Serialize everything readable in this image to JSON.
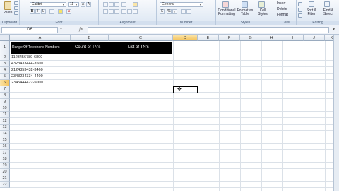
{
  "ribbon": {
    "clipboard": {
      "paste_label": "Paste",
      "group_label": "Clipboard"
    },
    "font": {
      "font_name": "Calibri",
      "font_size": "11",
      "bold": "B",
      "italic": "I",
      "underline": "U",
      "group_label": "Font"
    },
    "alignment": {
      "group_label": "Alignment"
    },
    "number": {
      "format": "General",
      "currency": "$",
      "percent": "%",
      "comma": ",",
      "group_label": "Number"
    },
    "styles": {
      "conditional_formatting": "Conditional Formatting",
      "format_as_table": "Format as Table",
      "cell_styles": "Cell Styles",
      "group_label": "Styles"
    },
    "cells": {
      "insert": "Insert",
      "delete": "Delete",
      "format": "Format",
      "group_label": "Cells"
    },
    "editing": {
      "sort_filter": "Sort & Filter",
      "find_select": "Find & Select",
      "group_label": "Editing"
    }
  },
  "formula_bar": {
    "name_box": "D6",
    "fx_label": "fx",
    "formula": ""
  },
  "sheet": {
    "columns": [
      "A",
      "B",
      "C",
      "D",
      "E",
      "F",
      "G",
      "H",
      "I",
      "J",
      "K"
    ],
    "rows": [
      "1",
      "2",
      "3",
      "4",
      "5",
      "6",
      "7",
      "8",
      "9",
      "10",
      "11",
      "12",
      "13",
      "14",
      "15",
      "16",
      "17",
      "18",
      "19",
      "20",
      "21",
      "22"
    ],
    "selected_column": "D",
    "selected_row": "6",
    "header_cells": {
      "a1": "Range Of Telephone Numbers",
      "b1": "Count of TN's",
      "c1": "List of TN's"
    },
    "column_a_values": [
      "1123456789-6800",
      "4323433444-3500",
      "2124353432-3460",
      "2343234334-4400",
      "2345444422-5000"
    ]
  }
}
